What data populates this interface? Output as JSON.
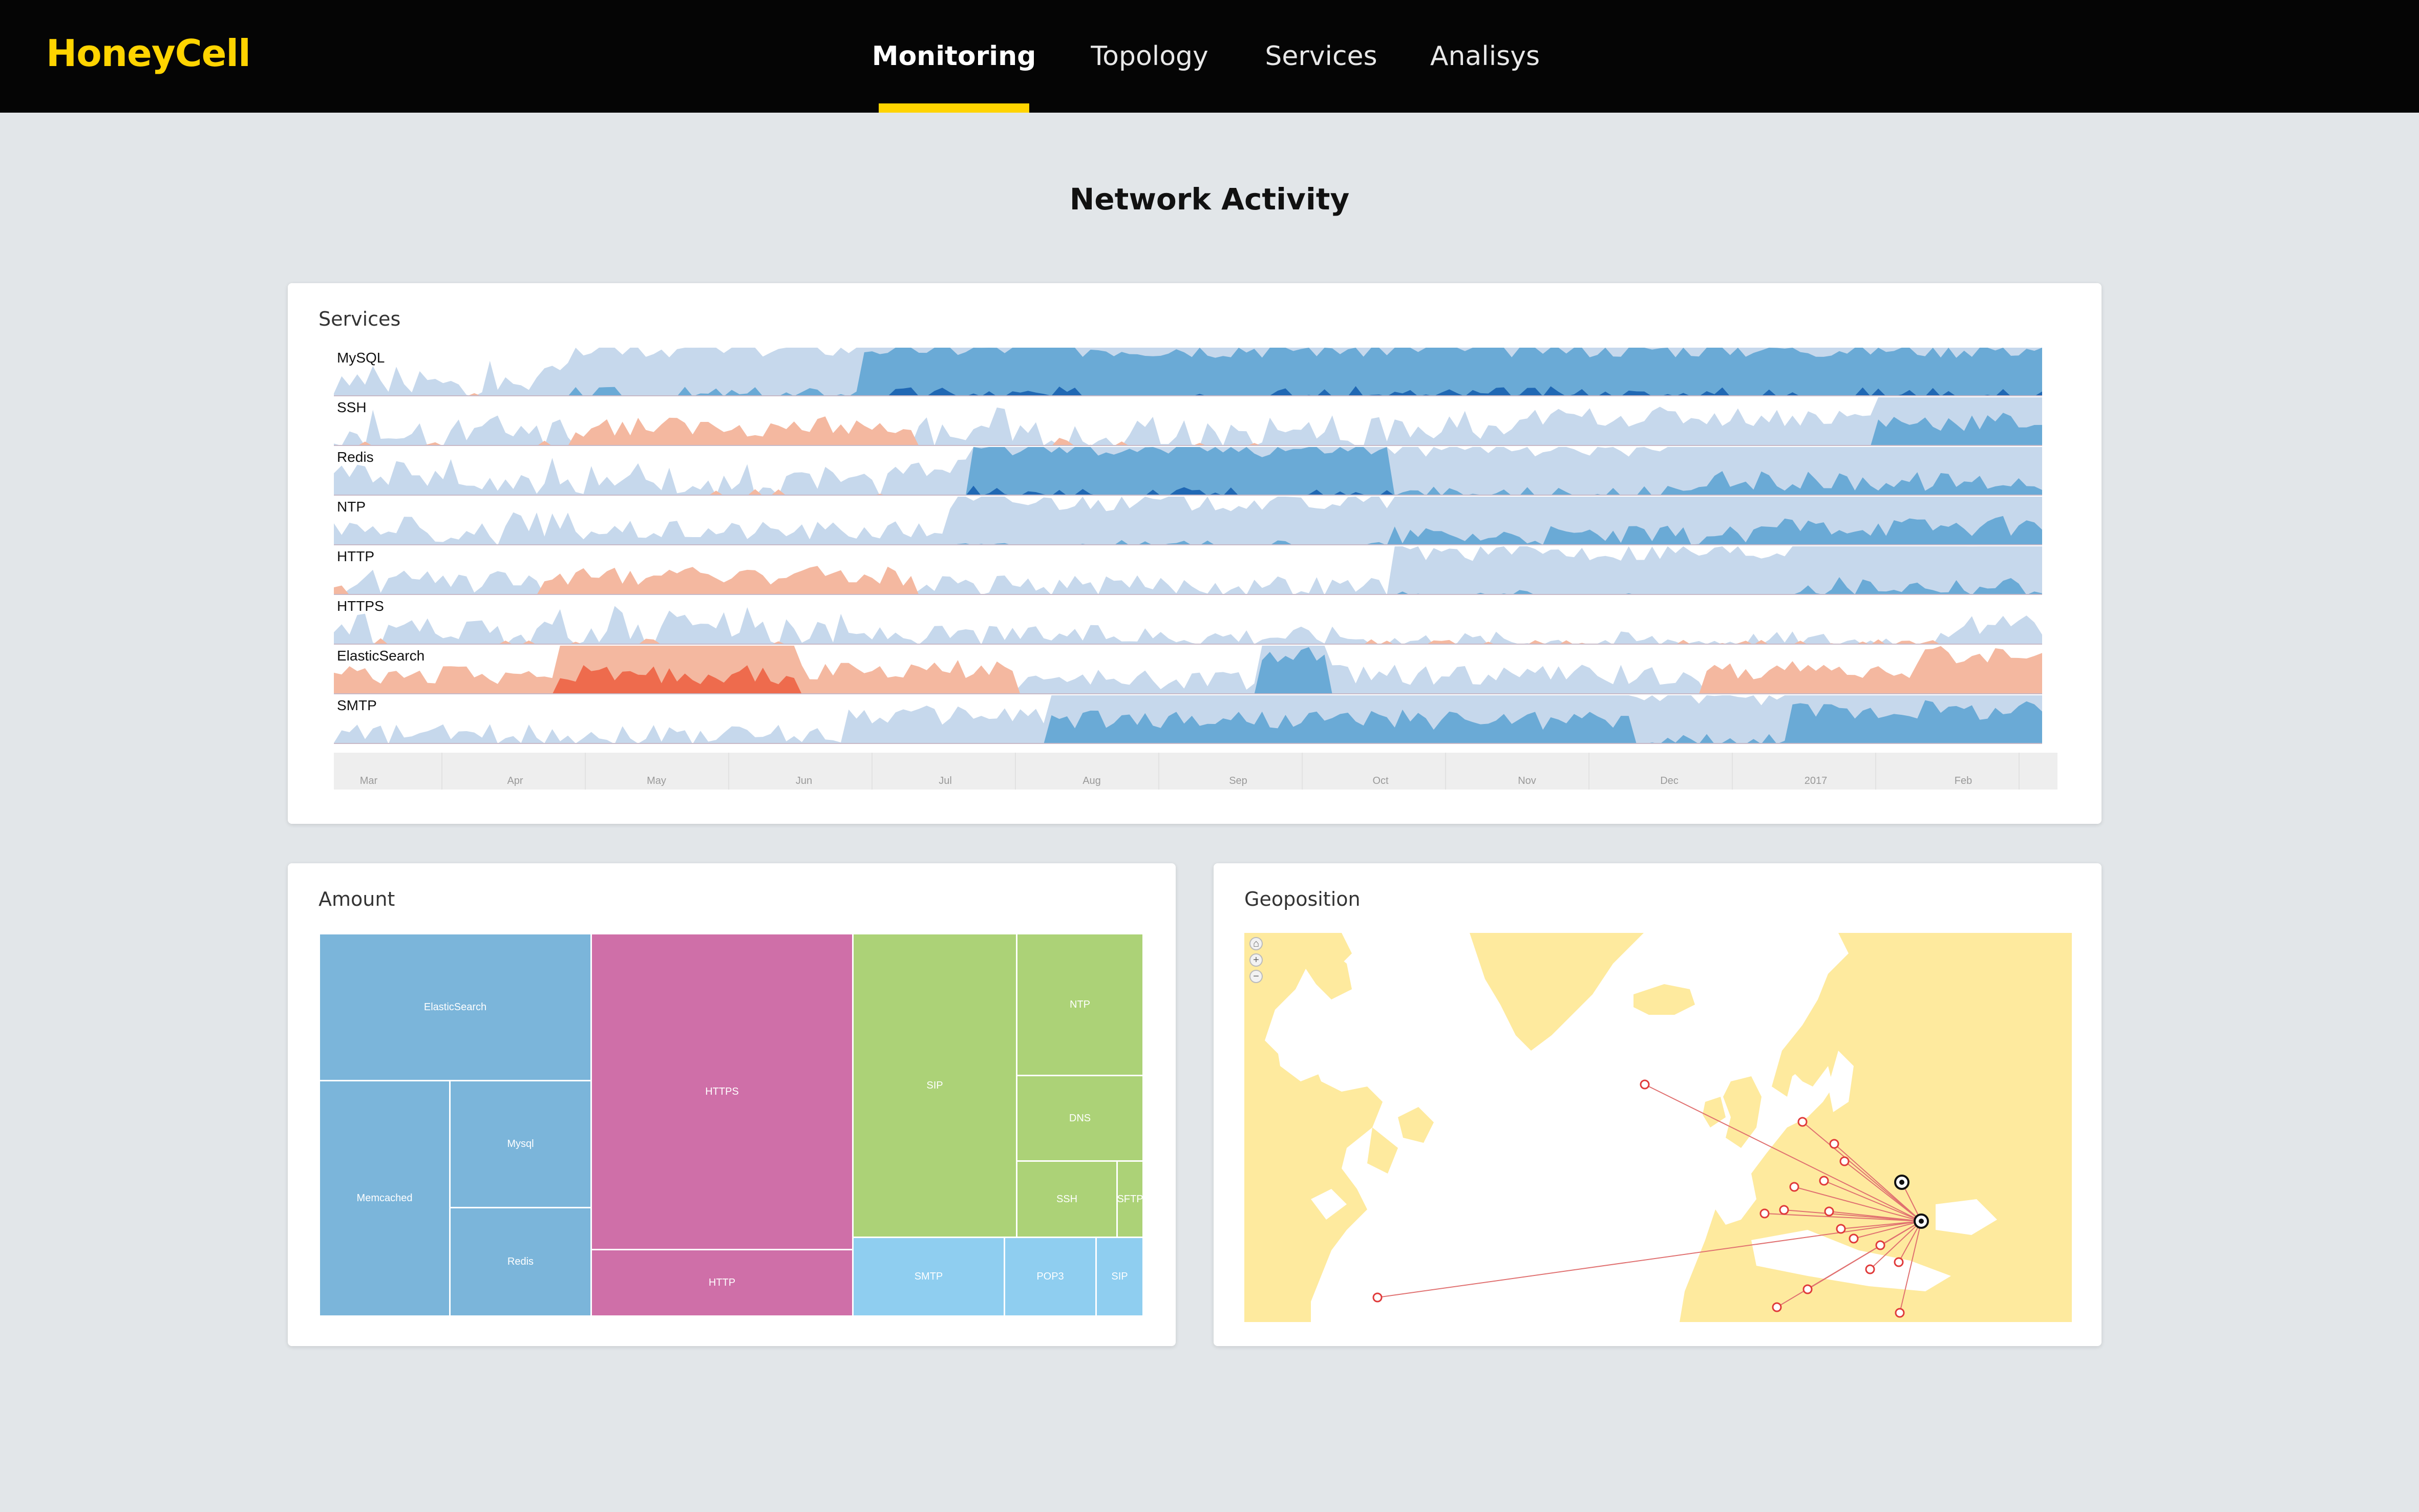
{
  "app": {
    "logo_part1": "Honey",
    "logo_part2": "Cell"
  },
  "nav": {
    "items": [
      {
        "label": "Monitoring",
        "active": true
      },
      {
        "label": "Topology",
        "active": false
      },
      {
        "label": "Services",
        "active": false
      },
      {
        "label": "Analisys",
        "active": false
      }
    ]
  },
  "page": {
    "title": "Network Activity"
  },
  "colors": {
    "accent": "#ffd400",
    "topbar": "#050505",
    "blue_bands": [
      "#c6d8ec",
      "#6aaad6",
      "#2068b4",
      "#1a5ca4"
    ],
    "red_bands": [
      "#f4b8a0",
      "#ee6b4d",
      "#cc3320"
    ],
    "map_land": "#feea9e",
    "map_route": "#e07070"
  },
  "services_card": {
    "title": "Services",
    "rows": [
      {
        "label": "MySQL"
      },
      {
        "label": "SSH"
      },
      {
        "label": "Redis"
      },
      {
        "label": "NTP"
      },
      {
        "label": "HTTP"
      },
      {
        "label": "HTTPS"
      },
      {
        "label": "ElasticSearch"
      },
      {
        "label": "SMTP"
      }
    ],
    "axis_ticks": [
      "Mar",
      "Apr",
      "May",
      "Jun",
      "Jul",
      "Aug",
      "Sep",
      "Oct",
      "Nov",
      "Dec",
      "2017",
      "Feb"
    ]
  },
  "amount_card": {
    "title": "Amount",
    "tiles": [
      {
        "label": "ElasticSearch",
        "color": "#7bb5da"
      },
      {
        "label": "Memcached",
        "color": "#7bb5da"
      },
      {
        "label": "Mysql",
        "color": "#7bb5da"
      },
      {
        "label": "Redis",
        "color": "#7bb5da"
      },
      {
        "label": "HTTPS",
        "color": "#cf6fa8"
      },
      {
        "label": "HTTP",
        "color": "#cf6fa8"
      },
      {
        "label": "SIP",
        "color": "#acd277"
      },
      {
        "label": "NTP",
        "color": "#acd277"
      },
      {
        "label": "DNS",
        "color": "#acd277"
      },
      {
        "label": "SSH",
        "color": "#acd277"
      },
      {
        "label": "SFTP",
        "color": "#acd277"
      },
      {
        "label": "SMTP",
        "color": "#8fcef0"
      },
      {
        "label": "POP3",
        "color": "#8fcef0"
      },
      {
        "label": "SIP",
        "color": "#8fcef0"
      }
    ]
  },
  "geo_card": {
    "title": "Geoposition",
    "controls": [
      "home-icon",
      "zoom-in-icon",
      "zoom-out-icon"
    ]
  }
}
